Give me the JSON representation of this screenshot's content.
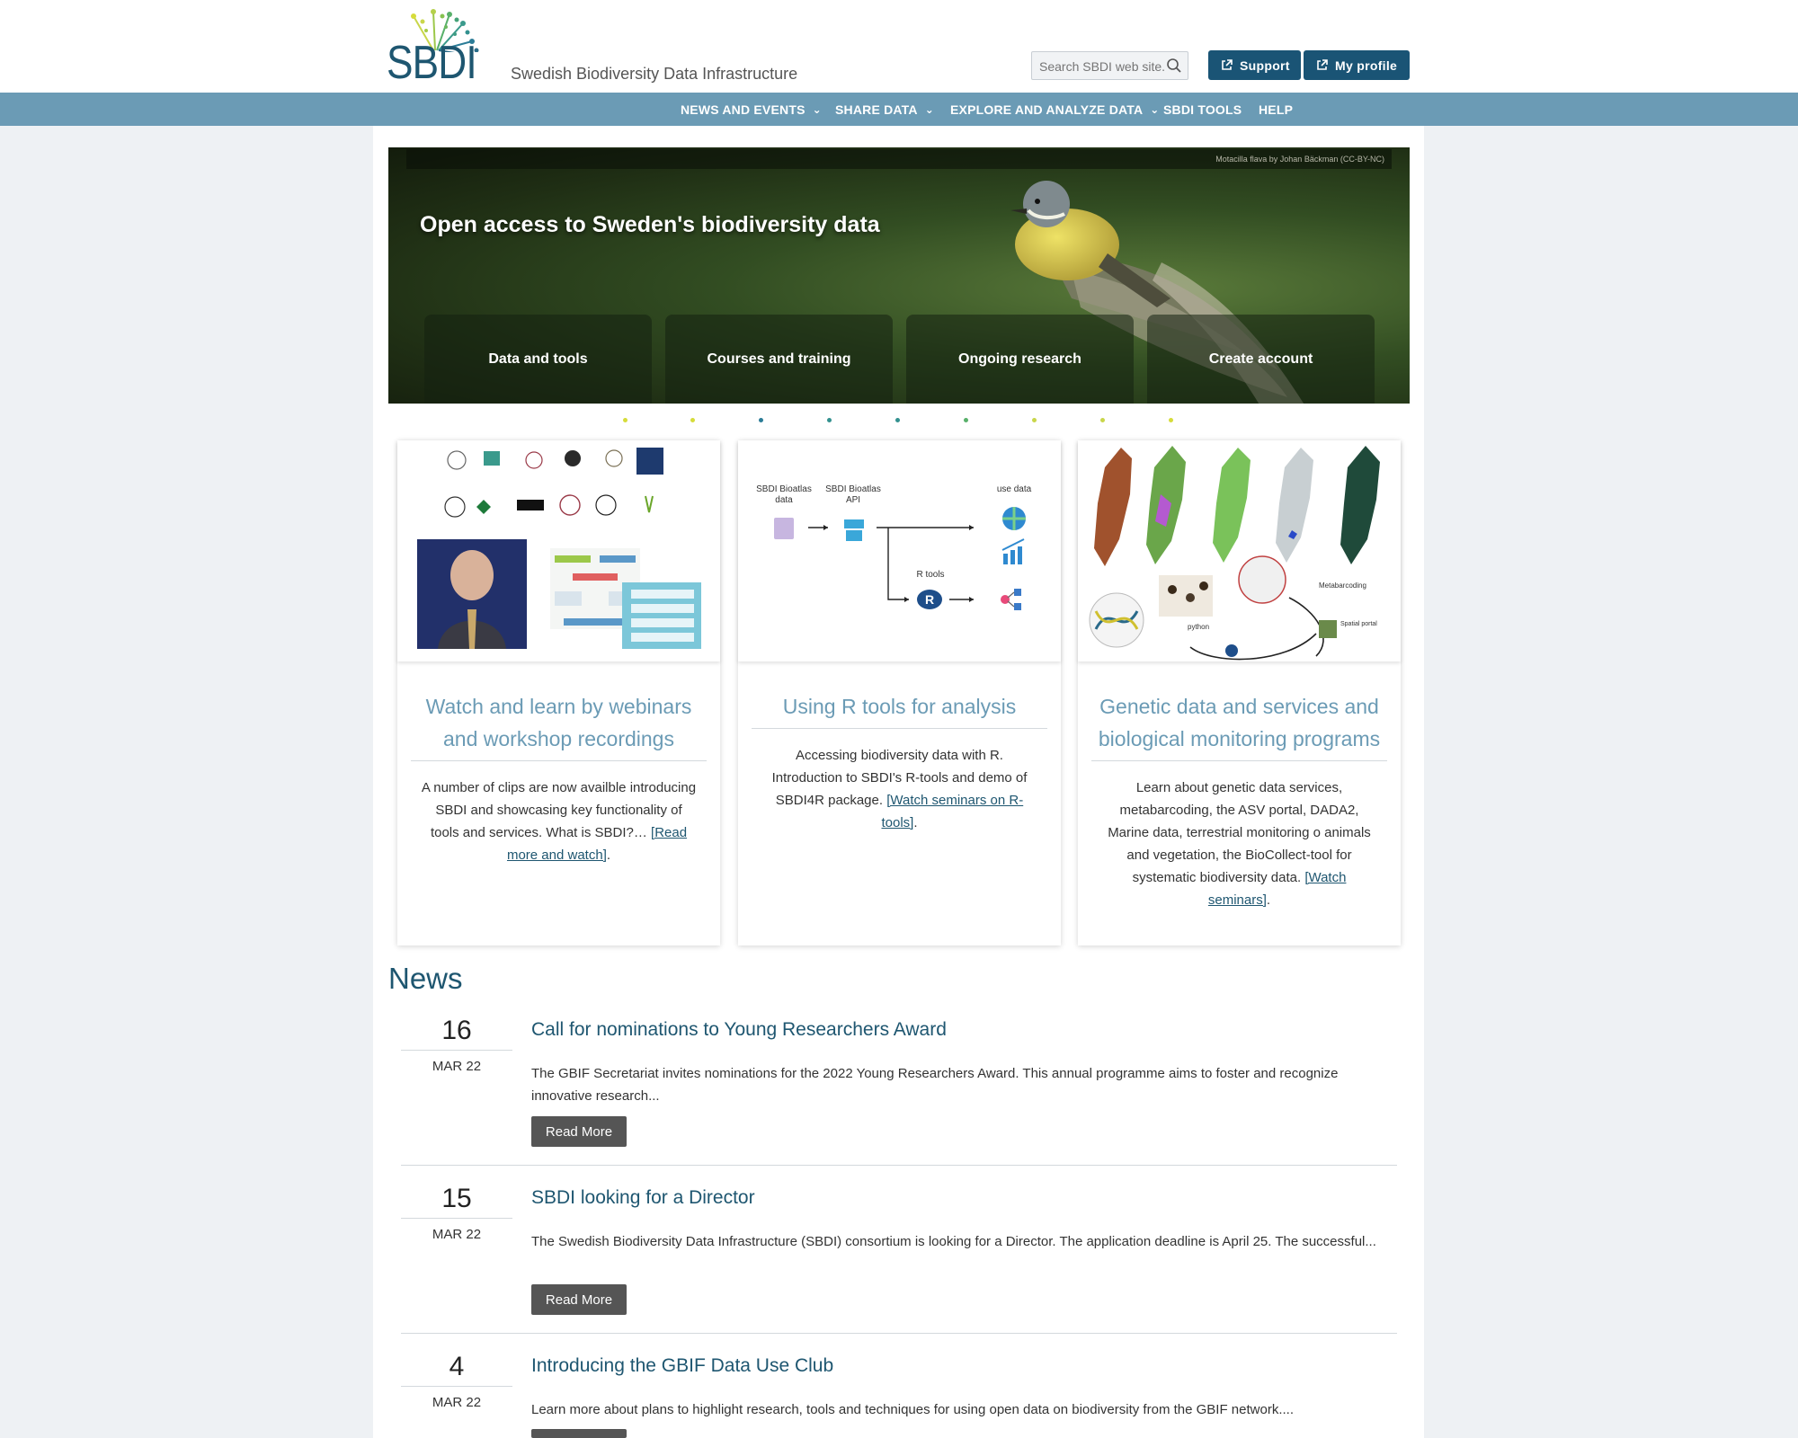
{
  "header": {
    "logo_text": "SBDI",
    "tagline": "Swedish Biodiversity Data Infrastructure",
    "search_placeholder": "Search SBDI web site...",
    "support_label": "Support",
    "profile_label": "My profile",
    "accent_color": "#1a5475"
  },
  "nav": {
    "items": [
      {
        "label": "NEWS AND EVENTS",
        "dropdown": true
      },
      {
        "label": "SHARE DATA",
        "dropdown": true
      },
      {
        "label": "EXPLORE AND ANALYZE DATA",
        "dropdown": true
      },
      {
        "label": "SBDI TOOLS",
        "dropdown": false
      },
      {
        "label": "HELP",
        "dropdown": false
      }
    ],
    "bar_color": "#6b9bb5"
  },
  "hero": {
    "credit": "Motacilla flava by Johan Bäckman (CC-BY-NC)",
    "title": "Open access to Sweden's biodiversity data",
    "tiles": [
      "Data and tools",
      "Courses and training",
      "Ongoing research",
      "Create account"
    ]
  },
  "cards": [
    {
      "title": "Watch and learn by webinars and workshop recordings",
      "text": "A number of clips are now availble introducing SBDI and showcasing key functionality of tools and services. What is SBDI?… ",
      "link": "[Read more and watch]",
      "suffix": "."
    },
    {
      "title": "Using R tools for analysis",
      "text": "Accessing biodiversity data with R. Introduction to SBDI's R-tools and demo of SBDI4R package. ",
      "link": "[Watch seminars on R-tools]",
      "suffix": ".",
      "diagram": {
        "labels": [
          "SBDI Bioatlas data",
          "SBDI Bioatlas API",
          "use data",
          "R tools"
        ]
      }
    },
    {
      "title": "Genetic data and services and biological monitoring programs",
      "text": "Learn about genetic data services, metabarcoding, the ASV portal, DADA2, Marine data, terrestrial monitoring o animals and vegetation, the BioCollect-tool for systematic biodiversity data. ",
      "link": "[Watch seminars]",
      "suffix": ".",
      "diagram": {
        "labels": [
          "Metabarcoding",
          "Spatial portal",
          "python"
        ]
      }
    }
  ],
  "news": {
    "heading": "News",
    "read_more": "Read More",
    "items": [
      {
        "day": "16",
        "month": "MAR 22",
        "title": "Call for nominations to Young Researchers Award",
        "excerpt": " The GBIF Secretariat invites nominations for the 2022 Young Researchers Award. This annual programme aims to foster and recognize innovative research..."
      },
      {
        "day": "15",
        "month": "MAR 22",
        "title": "SBDI looking for a Director",
        "excerpt": "The Swedish Biodiversity Data Infrastructure (SBDI) consortium is looking for a Director. The application deadline is April 25. The successful..."
      },
      {
        "day": "4",
        "month": "MAR 22",
        "title": "Introducing the GBIF Data Use Club",
        "excerpt": "Learn more about plans to highlight research, tools and techniques for using open data on biodiversity from the GBIF network...."
      }
    ]
  }
}
